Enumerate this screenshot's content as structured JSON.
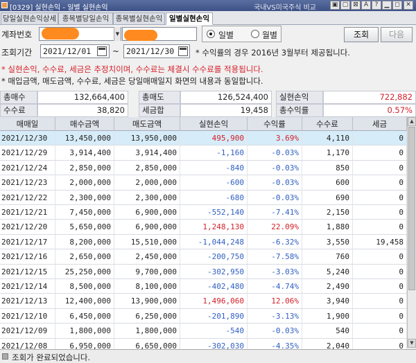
{
  "window": {
    "title": "[0329] 실현손익 - 일별 실현손익",
    "right_label": "국내VS미국주식 비교",
    "buttons": [
      "▣",
      "▢",
      "⊠",
      "A",
      "?",
      "▁",
      "◻",
      "✕"
    ]
  },
  "tabs": [
    {
      "label": "당일실현손익상세",
      "active": false
    },
    {
      "label": "종목별당일손익",
      "active": false
    },
    {
      "label": "종목별실현손익",
      "active": false
    },
    {
      "label": "일별실현손익",
      "active": true
    }
  ],
  "form": {
    "account_label": "계좌번호",
    "period_label": "조회기간",
    "start_date": "2021/12/01",
    "end_date": "2021/12/30",
    "separator": "~",
    "period_note": "* 수익률의 경우 2016년 3월부터 제공됩니다.",
    "radio_daily": "일별",
    "radio_monthly": "월별",
    "search_button": "조회",
    "next_button": "다음"
  },
  "notes": {
    "warning": "* 실현손익, 수수료, 세금은 추정치이며, 수수료는 체결시 수수료를 적용됩니다.",
    "info": "* 매입금액, 매도금액, 수수료, 세금은 당일매매일지 화면의 내용과 동일합니다."
  },
  "summary": {
    "total_buy_label": "총매수",
    "total_buy": "132,664,400",
    "total_sell_label": "총매도",
    "total_sell": "126,524,400",
    "realized_label": "실현손익",
    "realized": "722,882",
    "fee_label": "수수료",
    "fee": "38,820",
    "tax_label": "세금합",
    "tax": "19,458",
    "return_label": "총수익률",
    "return": "0.57%"
  },
  "columns": [
    "매매일",
    "매수금액",
    "매도금액",
    "실현손익",
    "수익률",
    "수수료",
    "세금"
  ],
  "rows": [
    {
      "date": "2021/12/30",
      "buy": "13,450,000",
      "sell": "13,950,000",
      "pnl": "495,900",
      "rate": "3.69%",
      "fee": "4,110",
      "tax": "0",
      "sign": "pos"
    },
    {
      "date": "2021/12/29",
      "buy": "3,914,400",
      "sell": "3,914,400",
      "pnl": "-1,160",
      "rate": "-0.03%",
      "fee": "1,170",
      "tax": "0",
      "sign": "neg"
    },
    {
      "date": "2021/12/24",
      "buy": "2,850,000",
      "sell": "2,850,000",
      "pnl": "-840",
      "rate": "-0.03%",
      "fee": "850",
      "tax": "0",
      "sign": "neg"
    },
    {
      "date": "2021/12/23",
      "buy": "2,000,000",
      "sell": "2,000,000",
      "pnl": "-600",
      "rate": "-0.03%",
      "fee": "600",
      "tax": "0",
      "sign": "neg"
    },
    {
      "date": "2021/12/22",
      "buy": "2,300,000",
      "sell": "2,300,000",
      "pnl": "-680",
      "rate": "-0.03%",
      "fee": "690",
      "tax": "0",
      "sign": "neg"
    },
    {
      "date": "2021/12/21",
      "buy": "7,450,000",
      "sell": "6,900,000",
      "pnl": "-552,140",
      "rate": "-7.41%",
      "fee": "2,150",
      "tax": "0",
      "sign": "neg"
    },
    {
      "date": "2021/12/20",
      "buy": "5,650,000",
      "sell": "6,900,000",
      "pnl": "1,248,130",
      "rate": "22.09%",
      "fee": "1,880",
      "tax": "0",
      "sign": "pos"
    },
    {
      "date": "2021/12/17",
      "buy": "8,200,000",
      "sell": "15,510,000",
      "pnl": "-1,044,248",
      "rate": "-6.32%",
      "fee": "3,550",
      "tax": "19,458",
      "sign": "neg"
    },
    {
      "date": "2021/12/16",
      "buy": "2,650,000",
      "sell": "2,450,000",
      "pnl": "-200,750",
      "rate": "-7.58%",
      "fee": "760",
      "tax": "0",
      "sign": "neg"
    },
    {
      "date": "2021/12/15",
      "buy": "25,250,000",
      "sell": "9,700,000",
      "pnl": "-302,950",
      "rate": "-3.03%",
      "fee": "5,240",
      "tax": "0",
      "sign": "neg"
    },
    {
      "date": "2021/12/14",
      "buy": "8,500,000",
      "sell": "8,100,000",
      "pnl": "-402,480",
      "rate": "-4.74%",
      "fee": "2,490",
      "tax": "0",
      "sign": "neg"
    },
    {
      "date": "2021/12/13",
      "buy": "12,400,000",
      "sell": "13,900,000",
      "pnl": "1,496,060",
      "rate": "12.06%",
      "fee": "3,940",
      "tax": "0",
      "sign": "pos"
    },
    {
      "date": "2021/12/10",
      "buy": "6,450,000",
      "sell": "6,250,000",
      "pnl": "-201,890",
      "rate": "-3.13%",
      "fee": "1,900",
      "tax": "0",
      "sign": "neg"
    },
    {
      "date": "2021/12/09",
      "buy": "1,800,000",
      "sell": "1,800,000",
      "pnl": "-540",
      "rate": "-0.03%",
      "fee": "540",
      "tax": "0",
      "sign": "neg"
    },
    {
      "date": "2021/12/08",
      "buy": "6,950,000",
      "sell": "6,650,000",
      "pnl": "-302,030",
      "rate": "-4.35%",
      "fee": "2,040",
      "tax": "0",
      "sign": "neg"
    }
  ],
  "status": {
    "message": "조회가 완료되었습니다."
  },
  "colors": {
    "positive": "#d2202a",
    "negative": "#2f5fc4",
    "selected_row": "#d6ecf8",
    "redaction": "#ff8a1f"
  }
}
